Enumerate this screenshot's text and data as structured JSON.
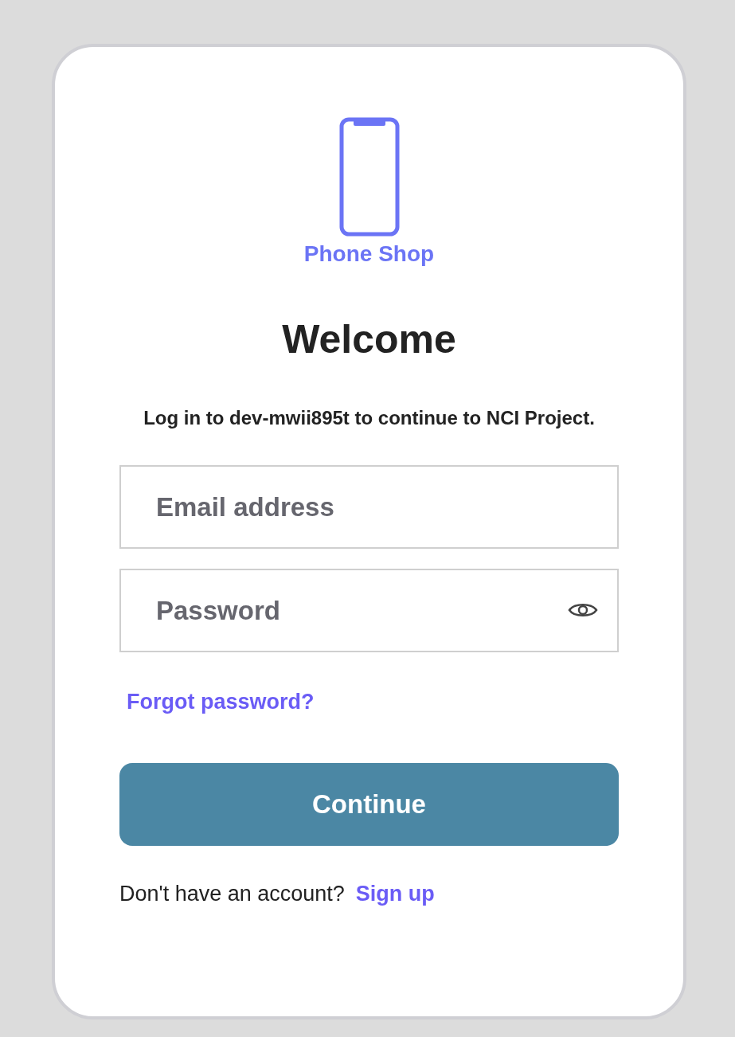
{
  "brand": {
    "name": "Phone Shop"
  },
  "title": "Welcome",
  "subtitle": "Log in to dev-mwii895t to continue to NCI Project.",
  "fields": [
    {
      "placeholder": "Email address",
      "kind": "email"
    },
    {
      "placeholder": "Password",
      "kind": "password"
    }
  ],
  "forgot_link": "Forgot password?",
  "submit": "Continue",
  "footer": {
    "text": "Don't have an account?",
    "link": "Sign up"
  }
}
